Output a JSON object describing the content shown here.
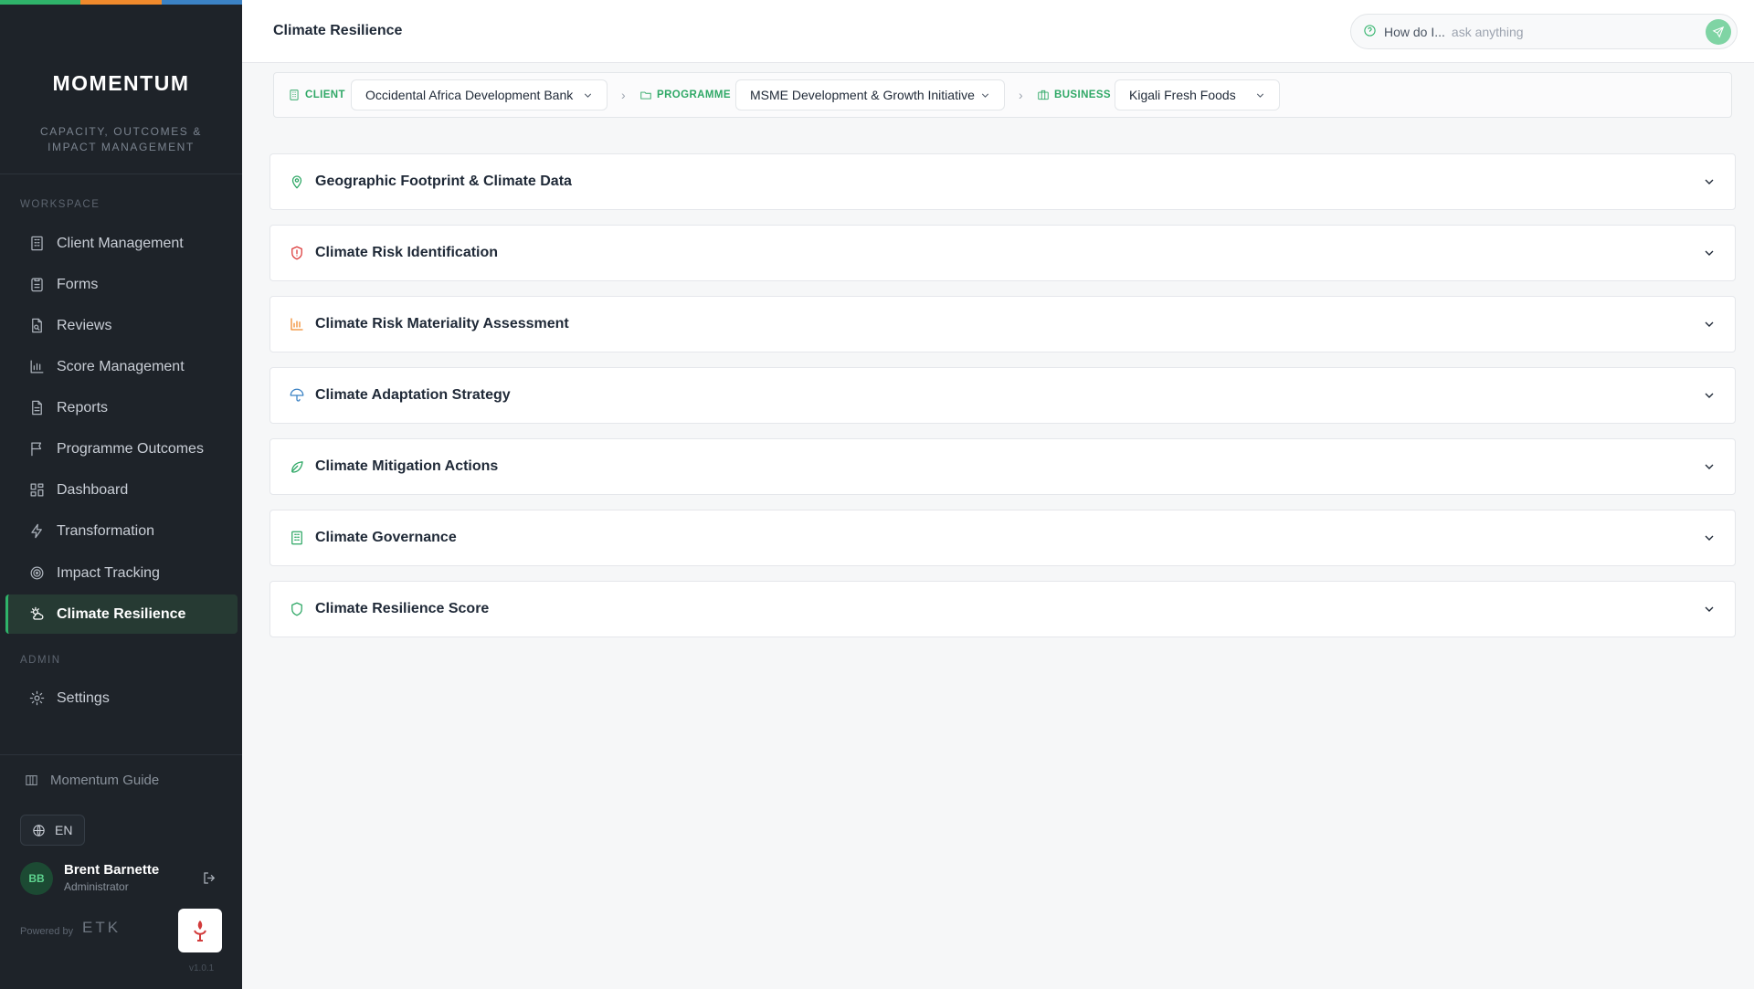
{
  "brand": {
    "logo": "MOMENTUM",
    "tagline": "CAPACITY, OUTCOMES & IMPACT MANAGEMENT",
    "stripe_colors": [
      "#2fb36a",
      "#f08a2c",
      "#3b82c4"
    ]
  },
  "sidebar": {
    "workspace_label": "WORKSPACE",
    "items": [
      {
        "label": "Client Management",
        "icon": "building-icon"
      },
      {
        "label": "Forms",
        "icon": "clipboard-icon"
      },
      {
        "label": "Reviews",
        "icon": "file-search-icon"
      },
      {
        "label": "Score Management",
        "icon": "bar-chart-icon"
      },
      {
        "label": "Reports",
        "icon": "document-icon"
      },
      {
        "label": "Programme Outcomes",
        "icon": "flag-icon"
      },
      {
        "label": "Dashboard",
        "icon": "grid-icon"
      },
      {
        "label": "Transformation",
        "icon": "bolt-icon"
      },
      {
        "label": "Impact Tracking",
        "icon": "target-icon"
      },
      {
        "label": "Climate Resilience",
        "icon": "sun-cloud-icon",
        "active": true
      }
    ],
    "admin_label": "ADMIN",
    "admin_items": [
      {
        "label": "Settings",
        "icon": "gear-icon"
      }
    ],
    "guide_label": "Momentum Guide",
    "language": "EN",
    "user": {
      "initials": "BB",
      "name": "Brent Barnette",
      "role": "Administrator"
    },
    "powered_by": "Powered by",
    "powered_brand": "ETK",
    "version": "v1.0.1"
  },
  "header": {
    "title": "Climate Resilience",
    "ask": {
      "prefix": "How do I...",
      "placeholder": "ask anything"
    }
  },
  "filters": {
    "client": {
      "label": "CLIENT",
      "value": "Occidental Africa Development Bank"
    },
    "programme": {
      "label": "PROGRAMME",
      "value": "MSME Development & Growth Initiative"
    },
    "business": {
      "label": "BUSINESS",
      "value": "Kigali Fresh Foods"
    },
    "separator": "›"
  },
  "sections": [
    {
      "title": "Geographic Footprint & Climate Data",
      "icon": "map-pin-icon",
      "color": "#2fa866"
    },
    {
      "title": "Climate Risk Identification",
      "icon": "shield-alert-icon",
      "color": "#dc3b3b"
    },
    {
      "title": "Climate Risk Materiality Assessment",
      "icon": "bar-chart-icon",
      "color": "#f08a2c"
    },
    {
      "title": "Climate Adaptation Strategy",
      "icon": "umbrella-icon",
      "color": "#3b82c4"
    },
    {
      "title": "Climate Mitigation Actions",
      "icon": "leaf-icon",
      "color": "#2fa866"
    },
    {
      "title": "Climate Governance",
      "icon": "building-icon",
      "color": "#2fa866"
    },
    {
      "title": "Climate Resilience Score",
      "icon": "shield-icon",
      "color": "#2fa866"
    }
  ],
  "colors": {
    "accent": "#2fb36a",
    "sidebar_bg": "#1e2329",
    "active_bg": "#263a33"
  }
}
